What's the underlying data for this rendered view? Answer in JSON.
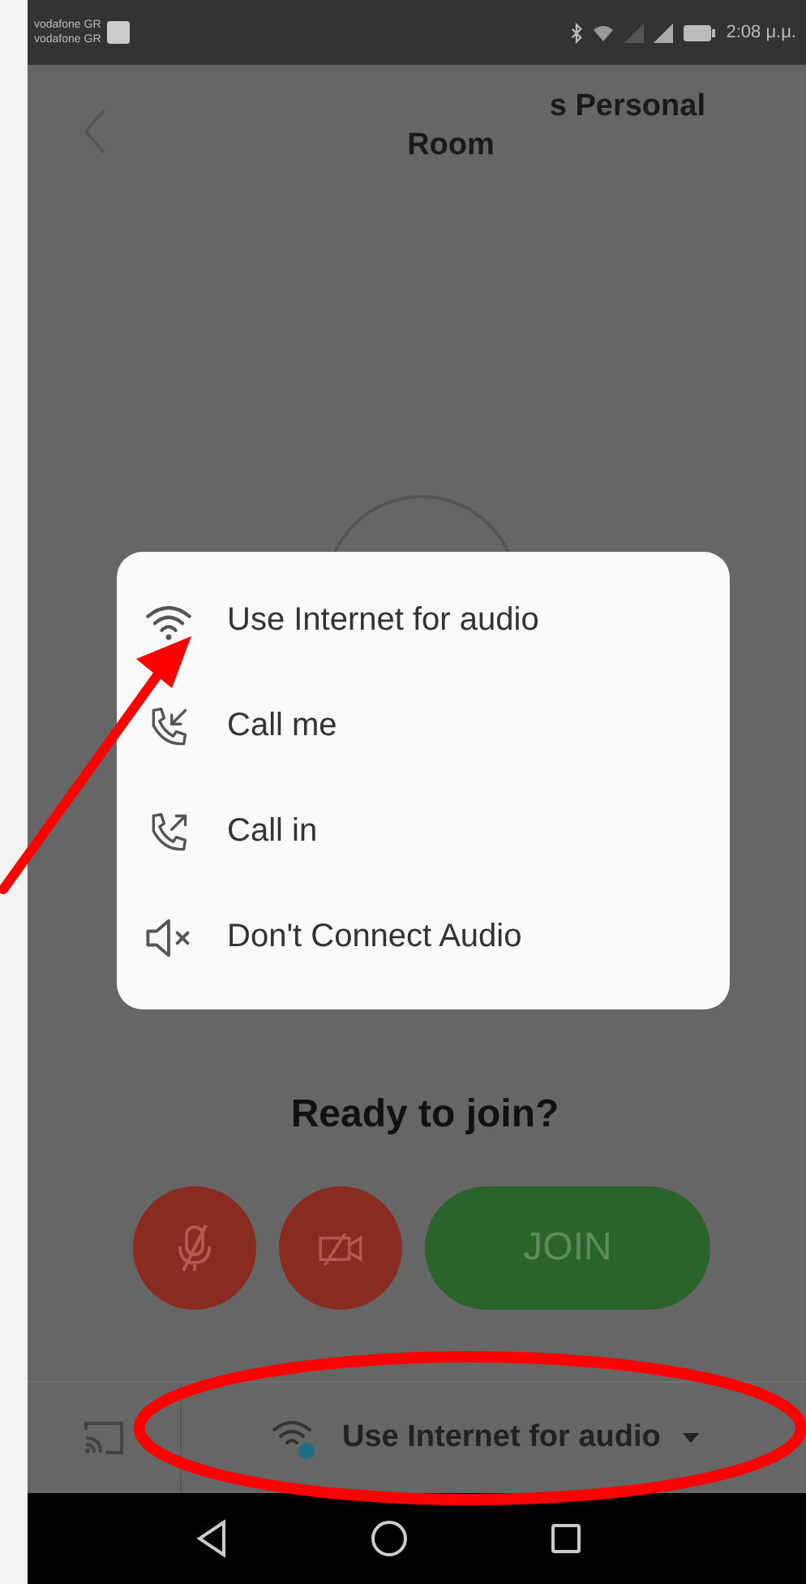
{
  "status_bar": {
    "carriers": [
      "vodafone GR",
      "vodafone GR"
    ],
    "time": "2:08 μ.μ."
  },
  "header": {
    "title_lines": [
      "s Personal",
      "Room"
    ]
  },
  "audio_menu": {
    "items": [
      {
        "kind": "internet",
        "label": "Use Internet for audio"
      },
      {
        "kind": "call_me",
        "label": "Call me"
      },
      {
        "kind": "call_in",
        "label": "Call in"
      },
      {
        "kind": "no_audio",
        "label": "Don't Connect Audio"
      }
    ]
  },
  "prompt": "Ready to join?",
  "controls": {
    "mic_muted": true,
    "video_off": true,
    "join_label": "JOIN"
  },
  "audio_selector": {
    "label": "Use Internet for audio"
  }
}
